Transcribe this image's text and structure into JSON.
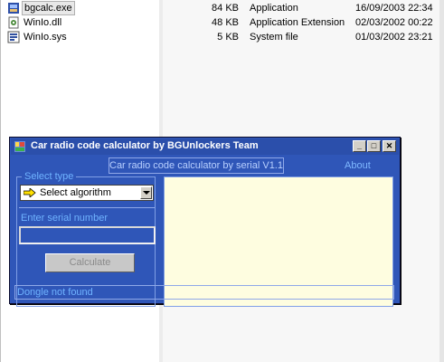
{
  "explorer": {
    "files": [
      {
        "name": "bgcalc.exe",
        "size": "84 KB",
        "type": "Application",
        "date": "16/09/2003 22:34",
        "icon": "exe-icon"
      },
      {
        "name": "WinIo.dll",
        "size": "48 KB",
        "type": "Application Extension",
        "date": "02/03/2002 00:22",
        "icon": "dll-icon"
      },
      {
        "name": "WinIo.sys",
        "size": "5 KB",
        "type": "System file",
        "date": "01/03/2002 23:21",
        "icon": "sys-file-icon"
      }
    ]
  },
  "window": {
    "title": "Car radio code calculator by BGUnlockers Team",
    "minimize": "_",
    "maximize": "□",
    "close": "✕"
  },
  "main": {
    "caption": "Car radio code calculator by serial V1.1",
    "about": "About",
    "select_type_label": "Select type",
    "algorithm_value": "Select algorithm",
    "serial_label": "Enter serial number",
    "serial_value": "",
    "calculate_label": "Calculate",
    "output_text": ""
  },
  "status": {
    "text": "Dongle not found"
  },
  "colors": {
    "window_bg": "#2f56b8",
    "label_blue": "#6fb3ff",
    "output_bg": "#fffee0"
  }
}
